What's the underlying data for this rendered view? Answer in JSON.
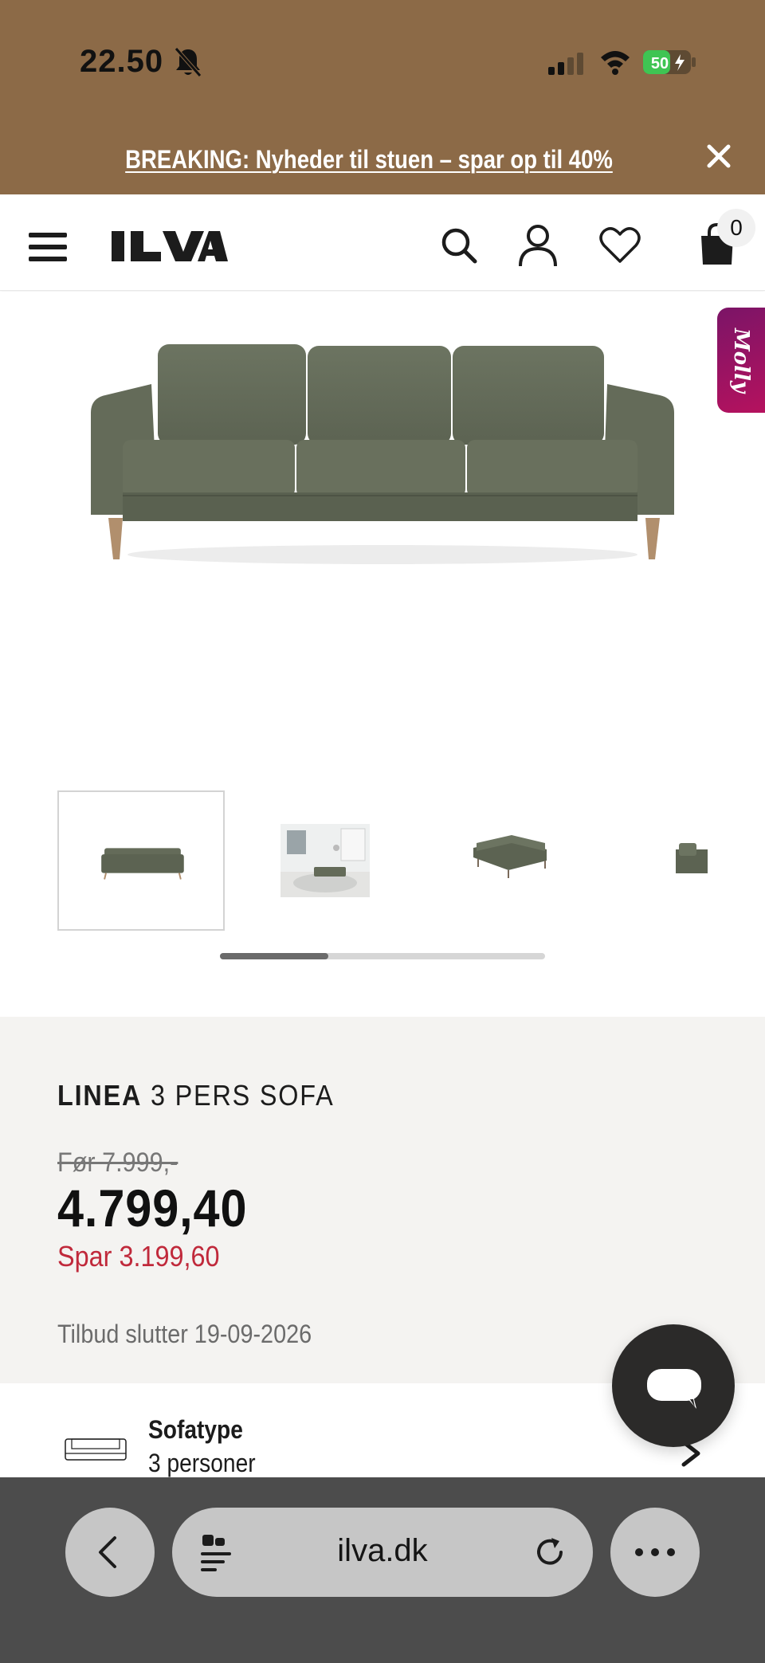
{
  "status_bar": {
    "time": "22.50",
    "battery": "50",
    "icons": [
      "bell-muted-icon",
      "signal-icon",
      "wifi-icon",
      "battery-icon"
    ]
  },
  "announcement": {
    "text": "BREAKING: Nyheder til stuen – spar op til 40%",
    "close_icon": "close-icon"
  },
  "header": {
    "logo": "ILVA",
    "cart_count": "0",
    "icons": [
      "menu-icon",
      "search-icon",
      "user-icon",
      "heart-icon",
      "bag-icon"
    ]
  },
  "assistant": {
    "label": "Molly"
  },
  "gallery": {
    "thumbnail_count": 4,
    "selected_index": 0,
    "scroll_position": 0.33
  },
  "product": {
    "brand": "LINEA",
    "name": "3 PERS SOFA",
    "old_price": "Før 7.999,-",
    "price": "4.799,40",
    "saving": "Spar 3.199,60",
    "offer_end": "Tilbud slutter 19-09-2026"
  },
  "spec": {
    "label": "Sofatype",
    "value": "3 personer"
  },
  "browser": {
    "url": "ilva.dk"
  },
  "colors": {
    "brand_brown": "#8c6a47",
    "sale_red": "#c0293b",
    "molly_gradient": "#7b1467"
  }
}
